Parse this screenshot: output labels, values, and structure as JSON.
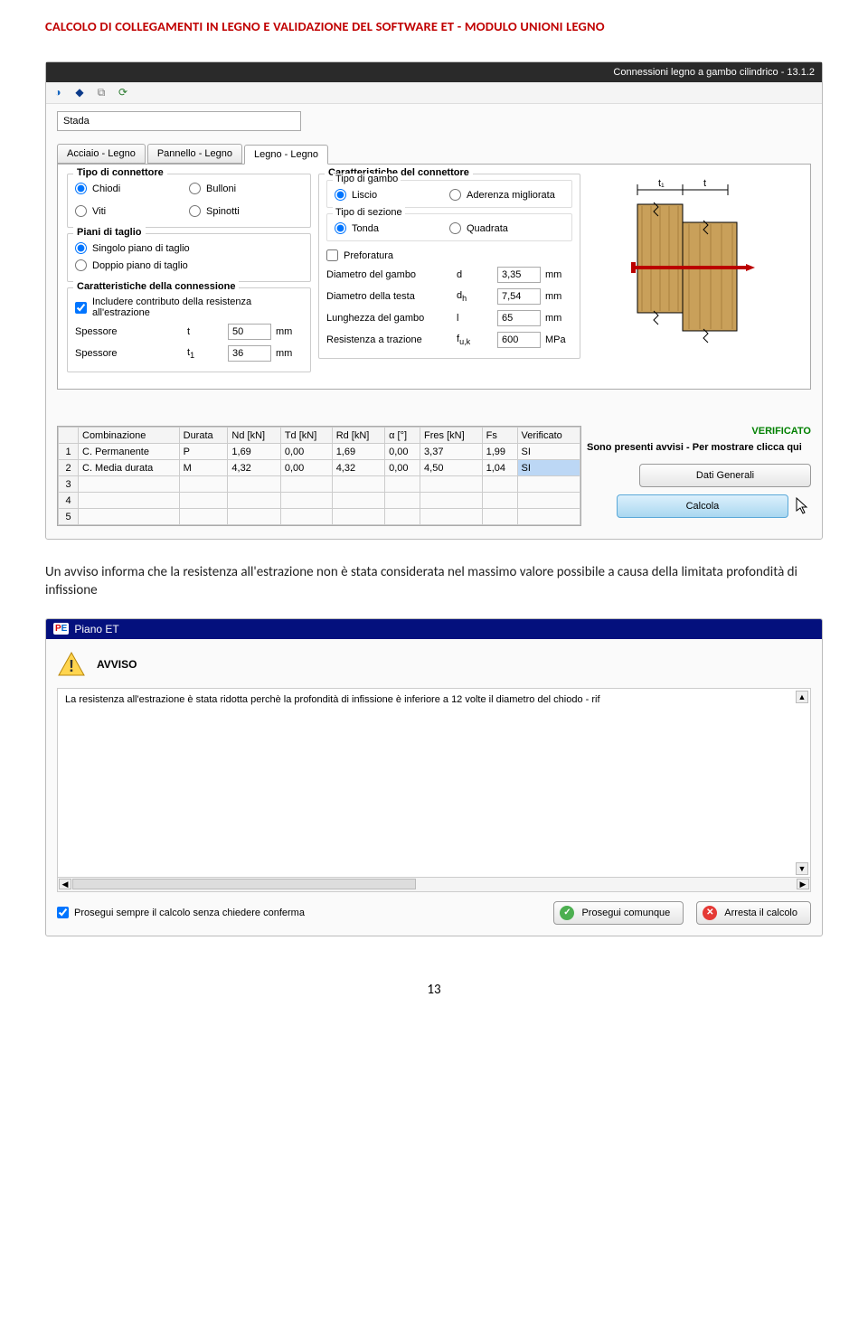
{
  "doc": {
    "title": "CALCOLO DI COLLEGAMENTI IN LEGNO E VALIDAZIONE DEL SOFTWARE ET - MODULO UNIONI LEGNO",
    "page_number": "13",
    "paragraph": "Un avviso informa che la resistenza all'estrazione non è stata considerata nel massimo valore possibile a causa della limitata profondità di infissione"
  },
  "panel1": {
    "titlebar": "Connessioni legno a gambo cilindrico - 13.1.2",
    "input_value": "Stada",
    "tabs": [
      "Acciaio - Legno",
      "Pannello - Legno",
      "Legno - Legno"
    ],
    "active_tab": 2,
    "groupA": {
      "tipo_connettore": {
        "legend": "Tipo di connettore",
        "opts": [
          "Chiodi",
          "Bulloni",
          "Viti",
          "Spinotti"
        ],
        "selected": 0
      },
      "piani": {
        "legend": "Piani di taglio",
        "opts": [
          "Singolo piano di taglio",
          "Doppio piano di taglio"
        ],
        "selected": 0
      },
      "caratt": {
        "legend": "Caratteristiche della connessione",
        "check": "Includere contributo della resistenza all'estrazione",
        "rows": [
          {
            "label": "Spessore",
            "sym": "t",
            "val": "50",
            "unit": "mm"
          },
          {
            "label": "Spessore",
            "sym": "t",
            "sub": "1",
            "val": "36",
            "unit": "mm"
          }
        ]
      }
    },
    "groupB": {
      "legend": "Caratteristiche del connettore",
      "gambo": {
        "legend": "Tipo di gambo",
        "opts": [
          "Liscio",
          "Aderenza migliorata"
        ],
        "selected": 0
      },
      "sezione": {
        "legend": "Tipo di sezione",
        "opts": [
          "Tonda",
          "Quadrata"
        ],
        "selected": 0
      },
      "preforatura": "Preforatura",
      "rows": [
        {
          "label": "Diametro del gambo",
          "sym": "d",
          "val": "3,35",
          "unit": "mm"
        },
        {
          "label": "Diametro della testa",
          "sym": "d",
          "sub": "h",
          "val": "7,54",
          "unit": "mm"
        },
        {
          "label": "Lunghezza del gambo",
          "sym": "l",
          "val": "65",
          "unit": "mm"
        },
        {
          "label": "Resistenza a trazione",
          "sym": "f",
          "sub": "u,k",
          "val": "600",
          "unit": "MPa"
        }
      ]
    },
    "diagram": {
      "t1": "t₁",
      "t": "t"
    },
    "table": {
      "headers": [
        "",
        "Combinazione",
        "Durata",
        "Nd [kN]",
        "Td [kN]",
        "Rd [kN]",
        "α [°]",
        "Fres [kN]",
        "Fs",
        "Verificato"
      ],
      "rows": [
        [
          "1",
          "C. Permanente",
          "P",
          "1,69",
          "0,00",
          "1,69",
          "0,00",
          "3,37",
          "1,99",
          "SI"
        ],
        [
          "2",
          "C. Media durata",
          "M",
          "4,32",
          "0,00",
          "4,32",
          "0,00",
          "4,50",
          "1,04",
          "SI"
        ],
        [
          "3",
          "",
          "",
          "",
          "",
          "",
          "",
          "",
          "",
          ""
        ],
        [
          "4",
          "",
          "",
          "",
          "",
          "",
          "",
          "",
          "",
          ""
        ],
        [
          "5",
          "",
          "",
          "",
          "",
          "",
          "",
          "",
          "",
          ""
        ]
      ]
    },
    "side": {
      "verificato": "VERIFICATO",
      "avvisi": "Sono presenti avvisi - Per mostrare clicca qui",
      "btn_dati": "Dati Generali",
      "btn_calcola": "Calcola"
    }
  },
  "panel2": {
    "title": "Piano ET",
    "heading": "AVVISO",
    "message": "La resistenza all'estrazione è stata ridotta perchè la profondità di infissione è inferiore a 12 volte il diametro del chiodo - rif",
    "checkbox": "Prosegui sempre il calcolo senza chiedere conferma",
    "btn_prosegui": "Prosegui comunque",
    "btn_arresta": "Arresta il calcolo"
  }
}
